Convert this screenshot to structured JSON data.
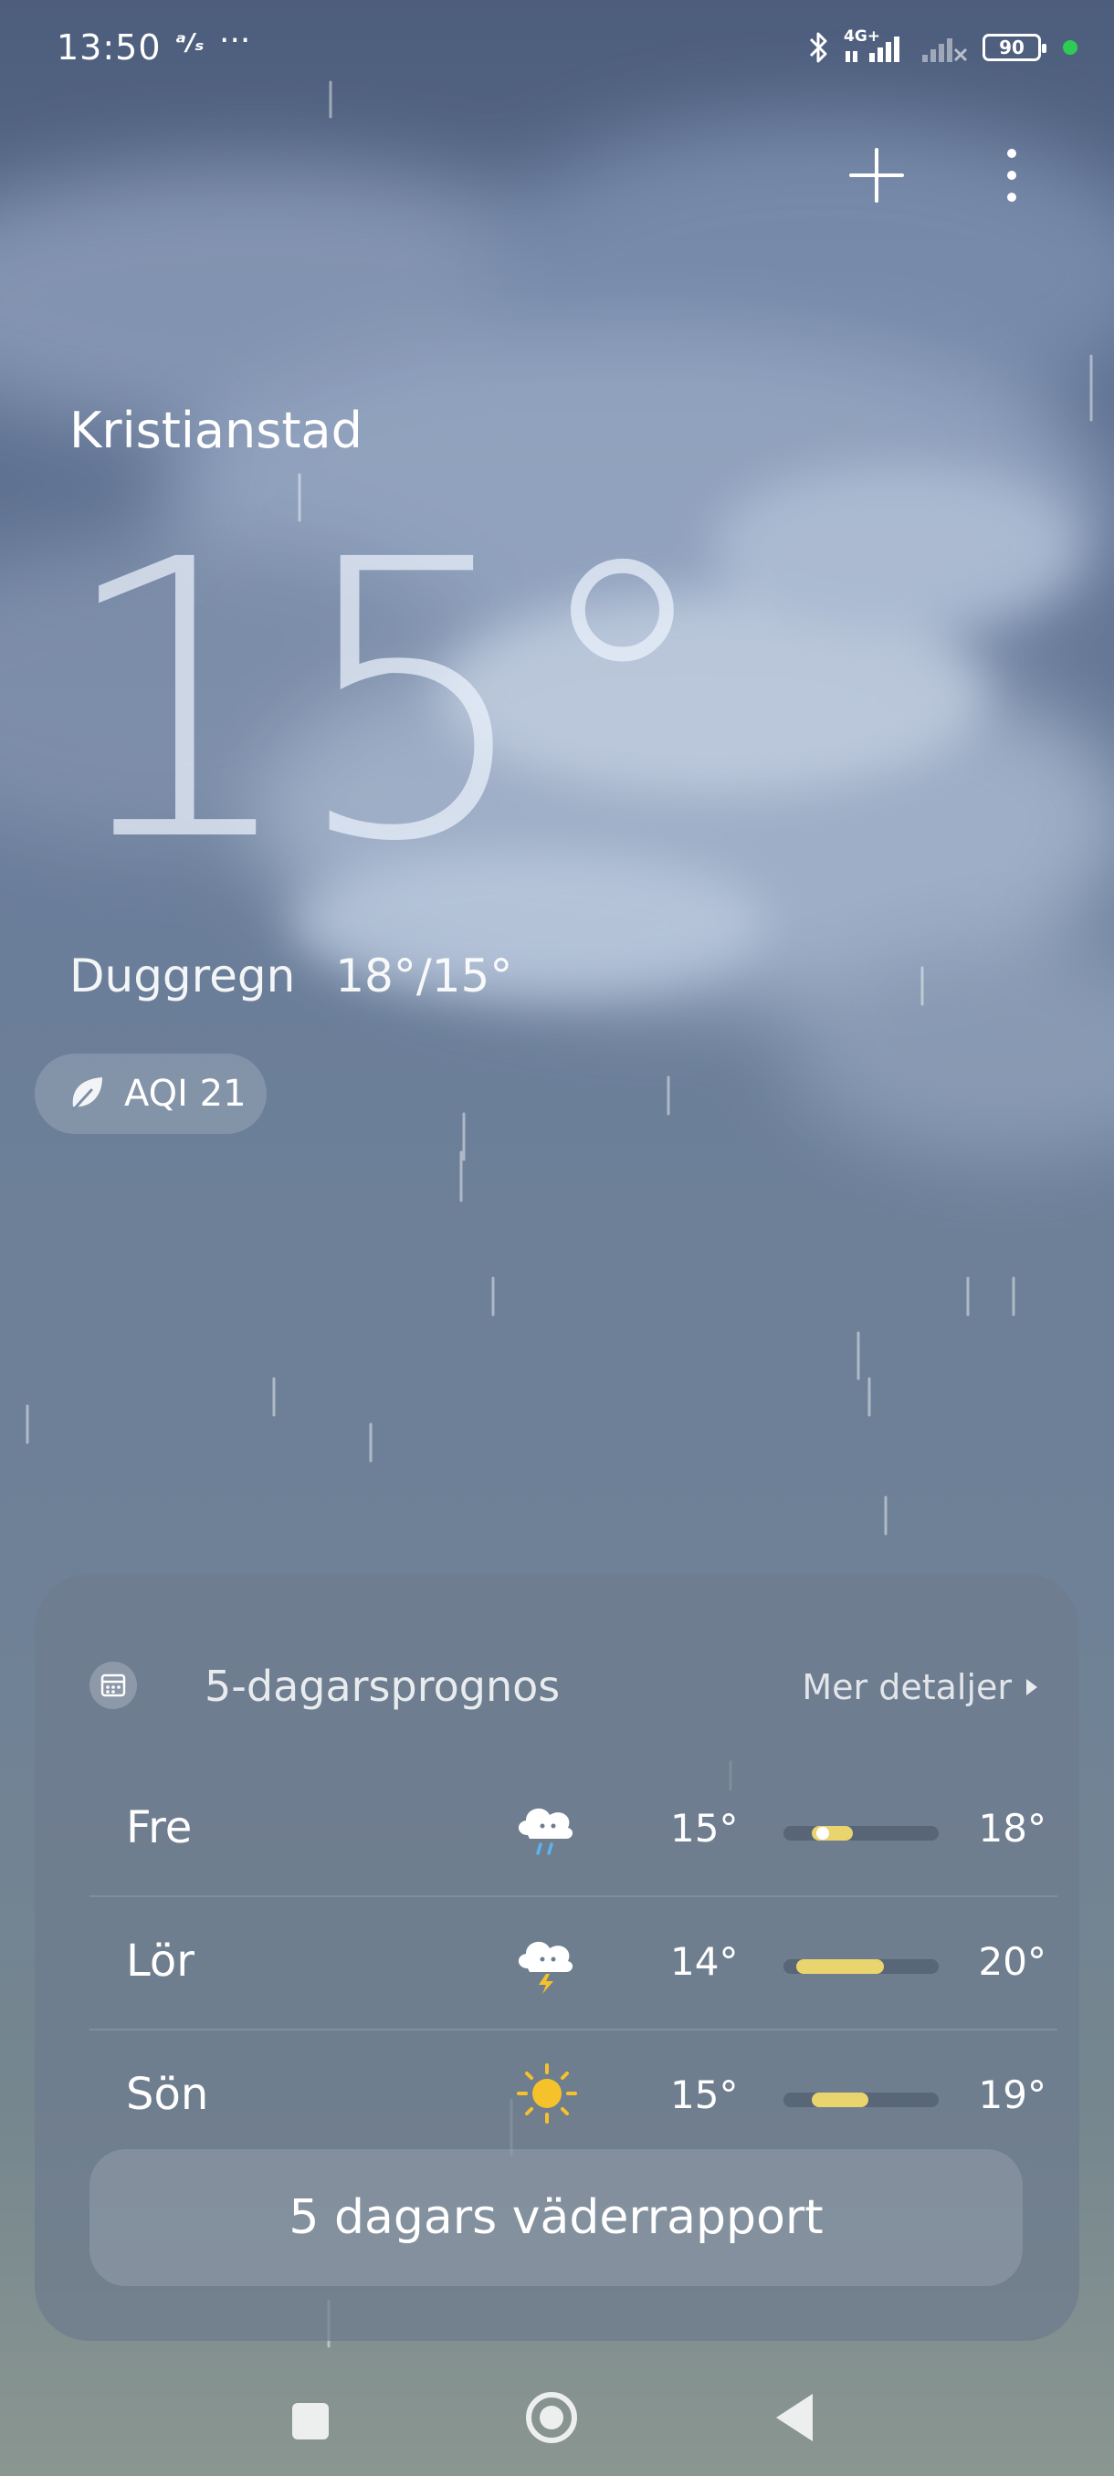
{
  "status_bar": {
    "time": "13:50",
    "extra_icon": "network-speed-icon",
    "dots": "···",
    "network_label": "4G+",
    "battery": "90",
    "indicator_color": "#2ecc54"
  },
  "location": {
    "city": "Kristianstad"
  },
  "current": {
    "temperature": "15°",
    "condition": "Duggregn",
    "range": "18°/15°",
    "aqi_label": "AQI 21"
  },
  "forecast": {
    "title": "5-dagarsprognos",
    "more_label": "Mer detaljer",
    "days": [
      {
        "day": "Fre",
        "icon": "cloud-rain-icon",
        "low": "15°",
        "high": "18°",
        "fill_start": 0.18,
        "fill_end": 0.45,
        "current": 0.25
      },
      {
        "day": "Lör",
        "icon": "cloud-thunder-icon",
        "low": "14°",
        "high": "20°",
        "fill_start": 0.08,
        "fill_end": 0.65
      },
      {
        "day": "Sön",
        "icon": "sun-icon",
        "low": "15°",
        "high": "19°",
        "fill_start": 0.18,
        "fill_end": 0.55
      }
    ],
    "report_button": "5 dagars väderrapport"
  },
  "colors": {
    "bar_fill": "#e9d46e",
    "sun": "#f6c22b"
  }
}
